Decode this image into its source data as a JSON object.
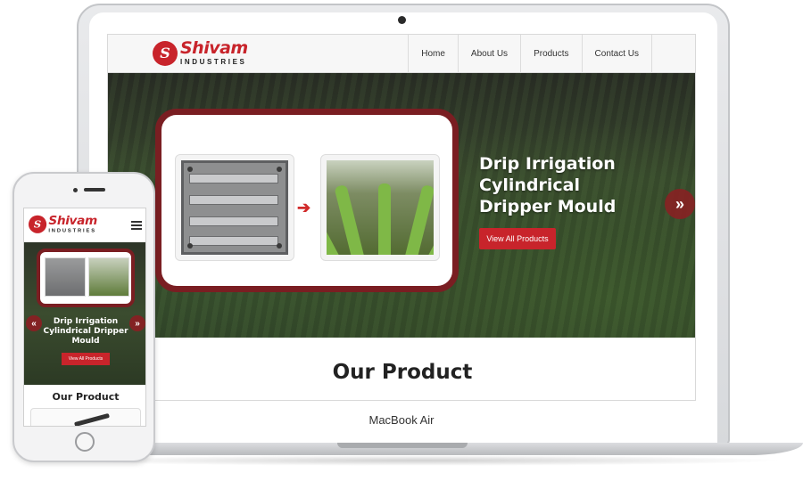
{
  "device_label": "MacBook Air",
  "site": {
    "logo": {
      "mark": "S",
      "name": "Shivam",
      "subtitle": "INDUSTRIES"
    },
    "nav": [
      {
        "label": "Home"
      },
      {
        "label": "About Us"
      },
      {
        "label": "Products"
      },
      {
        "label": "Contact Us"
      }
    ],
    "hero": {
      "title_lines": [
        "Drip Irrigation",
        "Cylindrical",
        "Dripper Mould"
      ],
      "button_label": "View All Products",
      "arrow_glyph": "➔",
      "next_glyph": "»"
    },
    "section_title": "Our Product"
  },
  "mobile": {
    "title": "Drip Irrigation Cylindrical Dripper Mould",
    "button_label": "View All Products",
    "prev_glyph": "«",
    "next_glyph": "»",
    "section_title": "Our Product"
  },
  "colors": {
    "brand_red": "#c8242b",
    "card_border": "#7a1e22"
  }
}
